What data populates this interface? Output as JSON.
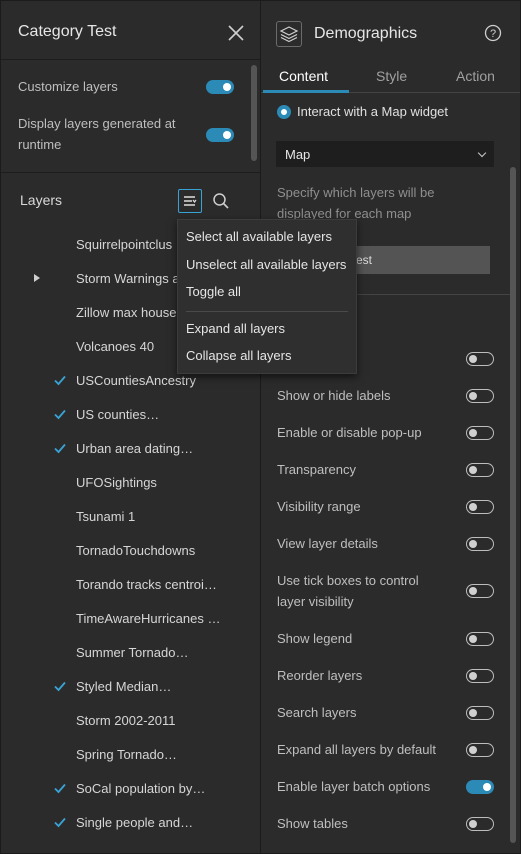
{
  "left_panel": {
    "title": "Category Test",
    "options": [
      {
        "label": "Customize layers",
        "enabled": true
      },
      {
        "label": "Display layers generated at runtime",
        "enabled": true
      }
    ],
    "layers_title": "Layers",
    "layers": [
      {
        "name": "Squirrelpointclus",
        "checked": false,
        "expandable": false
      },
      {
        "name": "Storm Warnings a",
        "checked": false,
        "expandable": true
      },
      {
        "name": "Zillow max house",
        "checked": false,
        "expandable": false
      },
      {
        "name": "Volcanoes 40",
        "checked": false,
        "expandable": false
      },
      {
        "name": "USCountiesAncestry",
        "checked": true,
        "expandable": false
      },
      {
        "name": "US counties…",
        "checked": true,
        "expandable": false
      },
      {
        "name": "Urban area dating…",
        "checked": true,
        "expandable": false
      },
      {
        "name": "UFOSightings",
        "checked": false,
        "expandable": false
      },
      {
        "name": "Tsunami 1",
        "checked": false,
        "expandable": false
      },
      {
        "name": "TornadoTouchdowns",
        "checked": false,
        "expandable": false
      },
      {
        "name": "Torando tracks centroi…",
        "checked": false,
        "expandable": false
      },
      {
        "name": "TimeAwareHurricanes …",
        "checked": false,
        "expandable": false
      },
      {
        "name": "Summer Tornado…",
        "checked": false,
        "expandable": false
      },
      {
        "name": "Styled Median…",
        "checked": true,
        "expandable": false
      },
      {
        "name": "Storm 2002-2011",
        "checked": false,
        "expandable": false
      },
      {
        "name": "Spring Tornado…",
        "checked": false,
        "expandable": false
      },
      {
        "name": "SoCal population by…",
        "checked": true,
        "expandable": false
      },
      {
        "name": "Single people and…",
        "checked": true,
        "expandable": false
      }
    ]
  },
  "menu": {
    "items": [
      "Select all available layers",
      "Unselect all available layers",
      "Toggle all",
      "Expand all layers",
      "Collapse all layers"
    ]
  },
  "right_panel": {
    "title": "Demographics",
    "tabs": [
      {
        "label": "Content",
        "active": true
      },
      {
        "label": "Style",
        "active": false
      },
      {
        "label": "Action",
        "active": false
      }
    ],
    "radio_label": "Interact with a Map widget",
    "map_select_value": "Map",
    "hint": "Specify which layers will be displayed for each map",
    "map_button_label": "est",
    "settings": [
      {
        "label": "",
        "enabled": false
      },
      {
        "label": "Show or hide labels",
        "enabled": false
      },
      {
        "label": "Enable or disable pop-up",
        "enabled": false
      },
      {
        "label": "Transparency",
        "enabled": false
      },
      {
        "label": "Visibility range",
        "enabled": false
      },
      {
        "label": "View layer details",
        "enabled": false
      },
      {
        "label": "Use tick boxes to control layer visibility",
        "enabled": false
      },
      {
        "label": "Show legend",
        "enabled": false
      },
      {
        "label": "Reorder layers",
        "enabled": false
      },
      {
        "label": "Search layers",
        "enabled": false
      },
      {
        "label": "Expand all layers by default",
        "enabled": false
      },
      {
        "label": "Enable layer batch options",
        "enabled": true
      },
      {
        "label": "Show tables",
        "enabled": false
      }
    ]
  },
  "colors": {
    "accent": "#2c8ab7",
    "panel": "#2b2b2b",
    "background": "#1b1b1b"
  }
}
